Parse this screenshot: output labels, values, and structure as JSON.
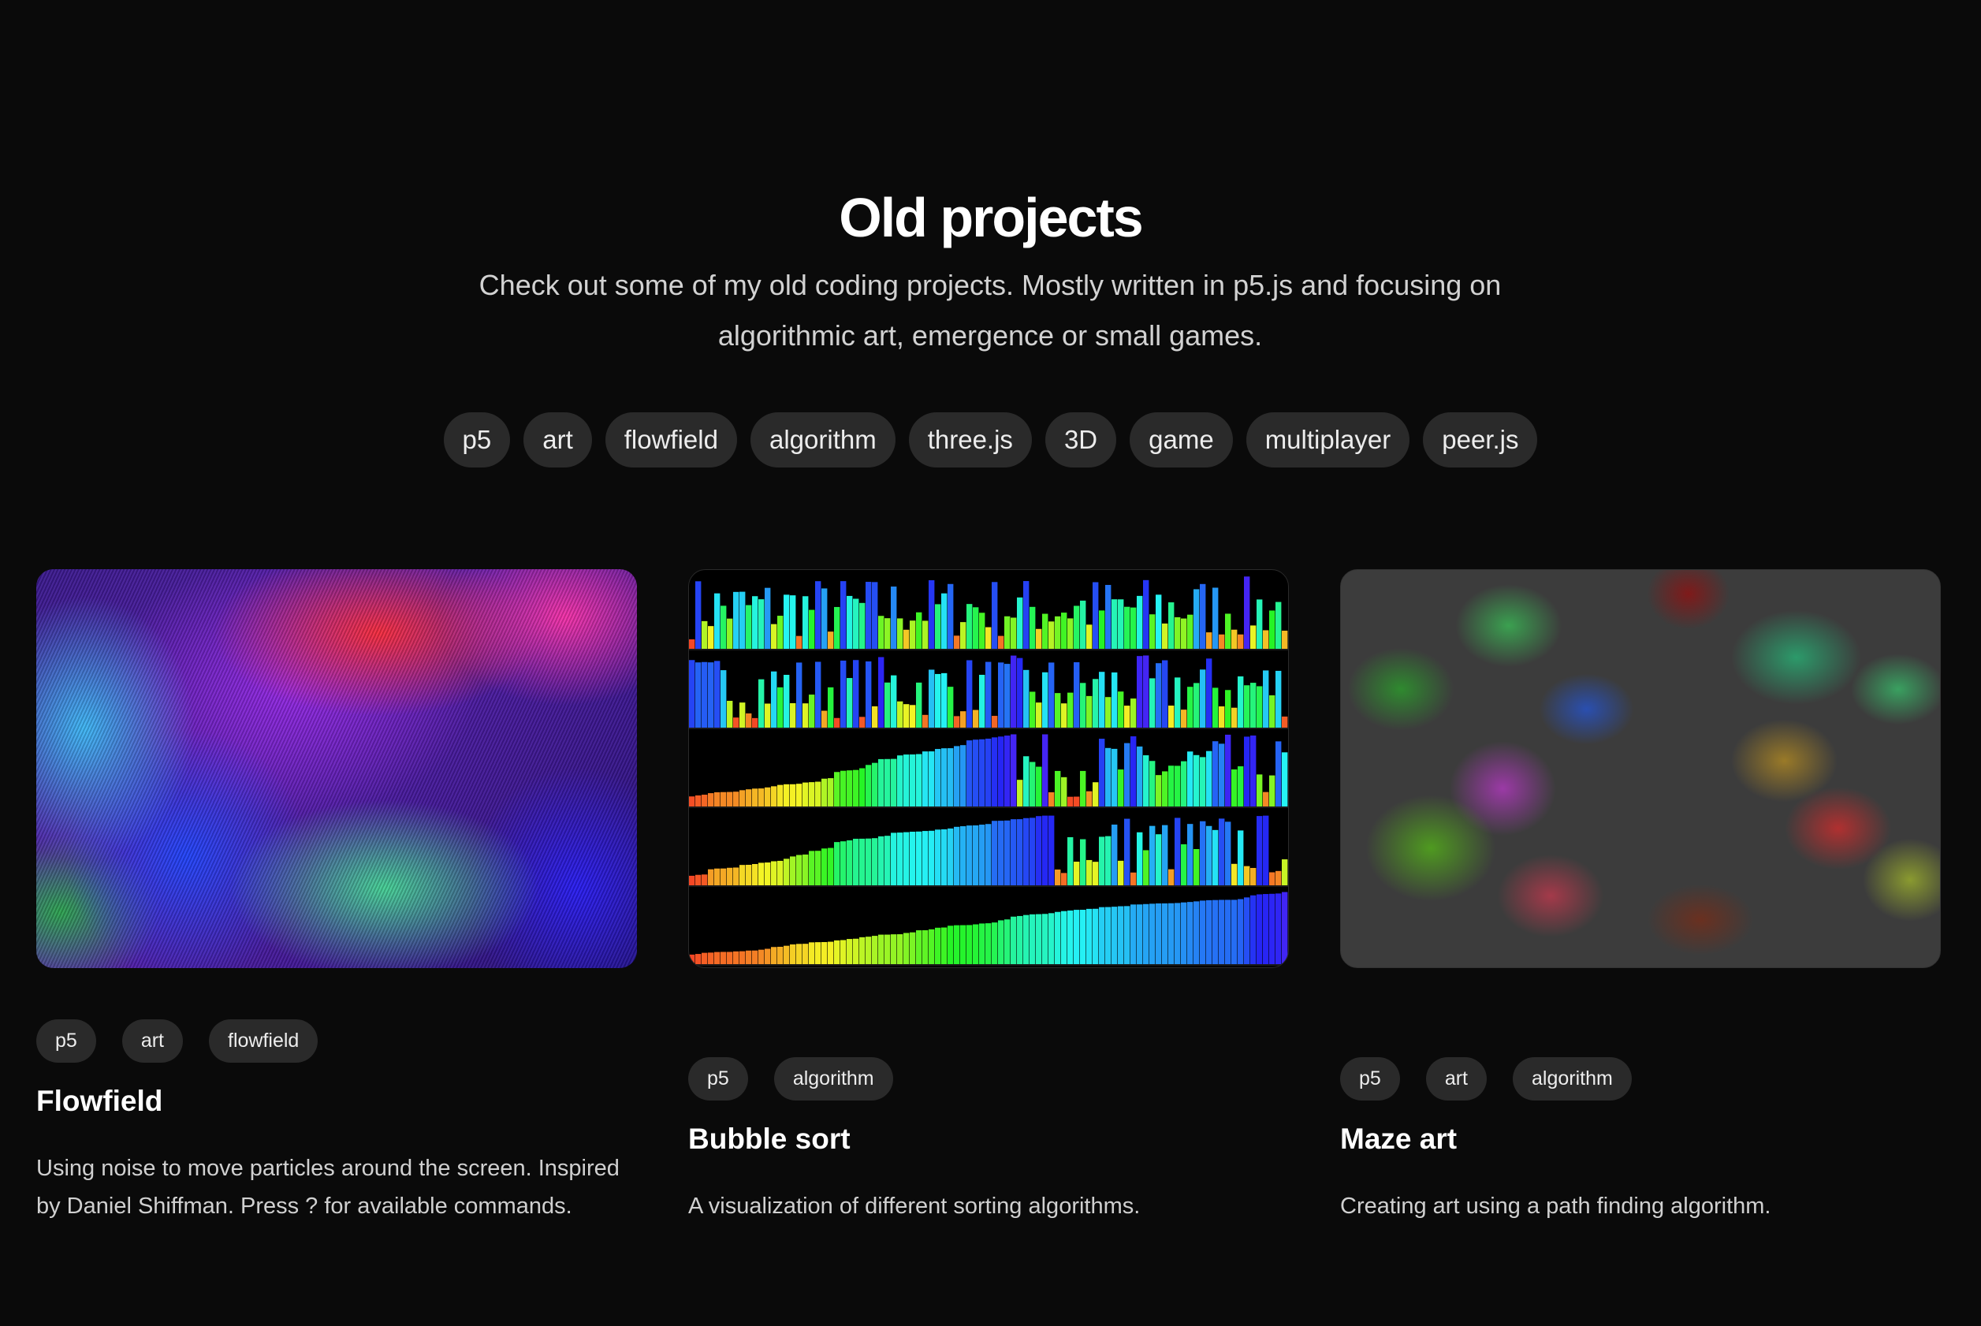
{
  "header": {
    "title": "Old projects",
    "subtitle": "Check out some of my old coding projects. Mostly written in p5.js and focusing on algorithmic art, emergence or small games."
  },
  "filters": [
    "p5",
    "art",
    "flowfield",
    "algorithm",
    "three.js",
    "3D",
    "game",
    "multiplayer",
    "peer.js"
  ],
  "projects": [
    {
      "title": "Flowfield",
      "tags": [
        "p5",
        "art",
        "flowfield"
      ],
      "description": "Using noise to move particles around the screen. Inspired by Daniel Shiffman. Press ? for available commands.",
      "thumbnail": "flowfield-thumbnail"
    },
    {
      "title": "Bubble sort",
      "tags": [
        "p5",
        "algorithm"
      ],
      "description": "A visualization of different sorting algorithms.",
      "thumbnail": "sorting-visualization-thumbnail"
    },
    {
      "title": "Maze art",
      "tags": [
        "p5",
        "art",
        "algorithm"
      ],
      "description": "Creating art using a path finding algorithm.",
      "thumbnail": "maze-art-thumbnail"
    }
  ],
  "colors": {
    "background": "#0a0a0a",
    "tag_background": "#2a2a2a",
    "text": "#ffffff",
    "muted_text": "#d2d2d2"
  }
}
